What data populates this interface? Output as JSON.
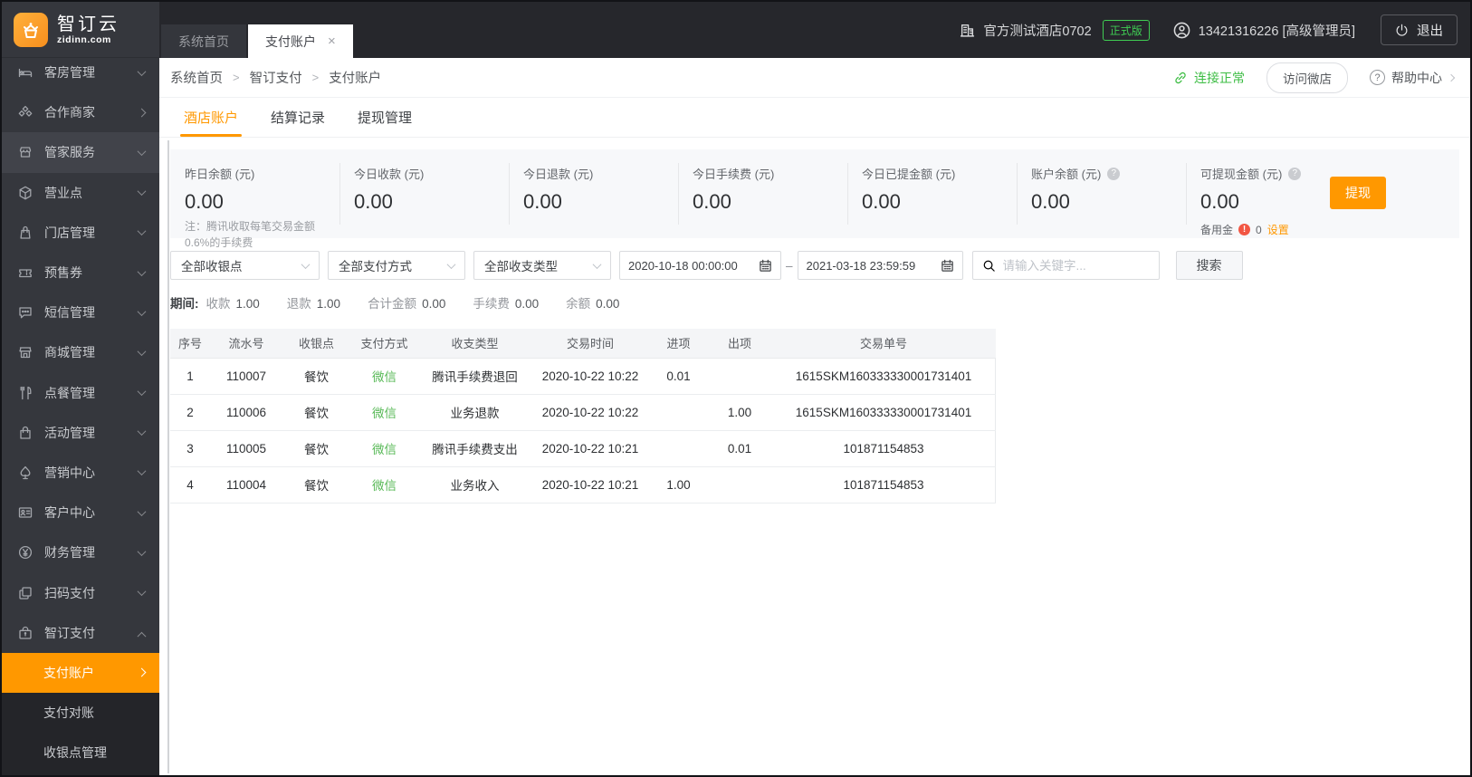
{
  "brand": {
    "title": "智订云",
    "domain": "zidinn.com"
  },
  "header": {
    "hotel": "官方测试酒店0702",
    "badge": "正式版",
    "user": "13421316226 [高级管理员]",
    "logout_label": "退出"
  },
  "window_tabs": [
    {
      "label": "系统首页",
      "active": false
    },
    {
      "label": "支付账户",
      "active": true,
      "closable": true
    }
  ],
  "breadcrumb": {
    "items": [
      "系统首页",
      "智订支付",
      "支付账户"
    ],
    "connection_status": "连接正常",
    "visit_shop_label": "访问微店",
    "help_label": "帮助中心"
  },
  "sidebar": {
    "items": [
      {
        "label": "客房管理",
        "icon": "rooms",
        "chevron": "down"
      },
      {
        "label": "合作商家",
        "icon": "partner",
        "chevron": "right"
      },
      {
        "label": "管家服务",
        "icon": "butler",
        "chevron": "down",
        "highlight": true
      },
      {
        "label": "营业点",
        "icon": "outlet",
        "chevron": "down"
      },
      {
        "label": "门店管理",
        "icon": "shop",
        "chevron": "down"
      },
      {
        "label": "预售券",
        "icon": "ticket",
        "chevron": "down"
      },
      {
        "label": "短信管理",
        "icon": "sms",
        "chevron": "down"
      },
      {
        "label": "商城管理",
        "icon": "mall",
        "chevron": "down"
      },
      {
        "label": "点餐管理",
        "icon": "food",
        "chevron": "down"
      },
      {
        "label": "活动管理",
        "icon": "activity",
        "chevron": "down"
      },
      {
        "label": "营销中心",
        "icon": "marketing",
        "chevron": "down"
      },
      {
        "label": "客户中心",
        "icon": "customer",
        "chevron": "down"
      },
      {
        "label": "财务管理",
        "icon": "finance",
        "chevron": "down"
      },
      {
        "label": "扫码支付",
        "icon": "scan",
        "chevron": "down"
      },
      {
        "label": "智订支付",
        "icon": "zpay",
        "chevron": "up"
      }
    ],
    "submenu": [
      {
        "label": "支付账户",
        "active": true
      },
      {
        "label": "支付对账",
        "active": false
      },
      {
        "label": "收银点管理",
        "active": false
      }
    ]
  },
  "page_tabs": [
    {
      "label": "酒店账户",
      "active": true
    },
    {
      "label": "结算记录",
      "active": false
    },
    {
      "label": "提现管理",
      "active": false
    }
  ],
  "stats": {
    "cards": [
      {
        "label": "昨日余额 (元)",
        "value": "0.00",
        "note": "注：腾讯收取每笔交易金额0.6%的手续费"
      },
      {
        "label": "今日收款 (元)",
        "value": "0.00"
      },
      {
        "label": "今日退款 (元)",
        "value": "0.00"
      },
      {
        "label": "今日手续费 (元)",
        "value": "0.00"
      },
      {
        "label": "今日已提金额 (元)",
        "value": "0.00"
      },
      {
        "label": "账户余额 (元)",
        "value": "0.00",
        "help": true
      },
      {
        "label": "可提现金额 (元)",
        "value": "0.00",
        "help": true
      }
    ],
    "withdraw_label": "提现",
    "reserve": {
      "label": "备用金",
      "value": "0",
      "action": "设置"
    }
  },
  "filters": {
    "selects": [
      "全部收银点",
      "全部支付方式",
      "全部收支类型"
    ],
    "date_from": "2020-10-18 00:00:00",
    "date_to": "2021-03-18 23:59:59",
    "search_placeholder": "请输入关键字...",
    "search_button": "搜索"
  },
  "summary": {
    "title": "期间:",
    "items": [
      {
        "label": "收款",
        "value": "1.00"
      },
      {
        "label": "退款",
        "value": "1.00"
      },
      {
        "label": "合计金额",
        "value": "0.00"
      },
      {
        "label": "手续费",
        "value": "0.00"
      },
      {
        "label": "余额",
        "value": "0.00"
      }
    ]
  },
  "table": {
    "columns": [
      "序号",
      "流水号",
      "收银点",
      "支付方式",
      "收支类型",
      "交易时间",
      "进项",
      "出项",
      "交易单号"
    ],
    "rows": [
      {
        "no": "1",
        "serial": "110007",
        "cashier": "餐饮",
        "method": "微信",
        "type": "腾讯手续费退回",
        "time": "2020-10-22 10:22",
        "in": "0.01",
        "out": "",
        "txn": "1615SKM160333330001731401"
      },
      {
        "no": "2",
        "serial": "110006",
        "cashier": "餐饮",
        "method": "微信",
        "type": "业务退款",
        "time": "2020-10-22 10:22",
        "in": "",
        "out": "1.00",
        "txn": "1615SKM160333330001731401"
      },
      {
        "no": "3",
        "serial": "110005",
        "cashier": "餐饮",
        "method": "微信",
        "type": "腾讯手续费支出",
        "time": "2020-10-22 10:21",
        "in": "",
        "out": "0.01",
        "txn": "101871154853"
      },
      {
        "no": "4",
        "serial": "110004",
        "cashier": "餐饮",
        "method": "微信",
        "type": "业务收入",
        "time": "2020-10-22 10:21",
        "in": "1.00",
        "out": "",
        "txn": "101871154853"
      }
    ]
  },
  "colors": {
    "accent": "#ff9800",
    "success": "#3fcd53",
    "wechat_green": "#58b957",
    "alert_red": "#f25643"
  }
}
